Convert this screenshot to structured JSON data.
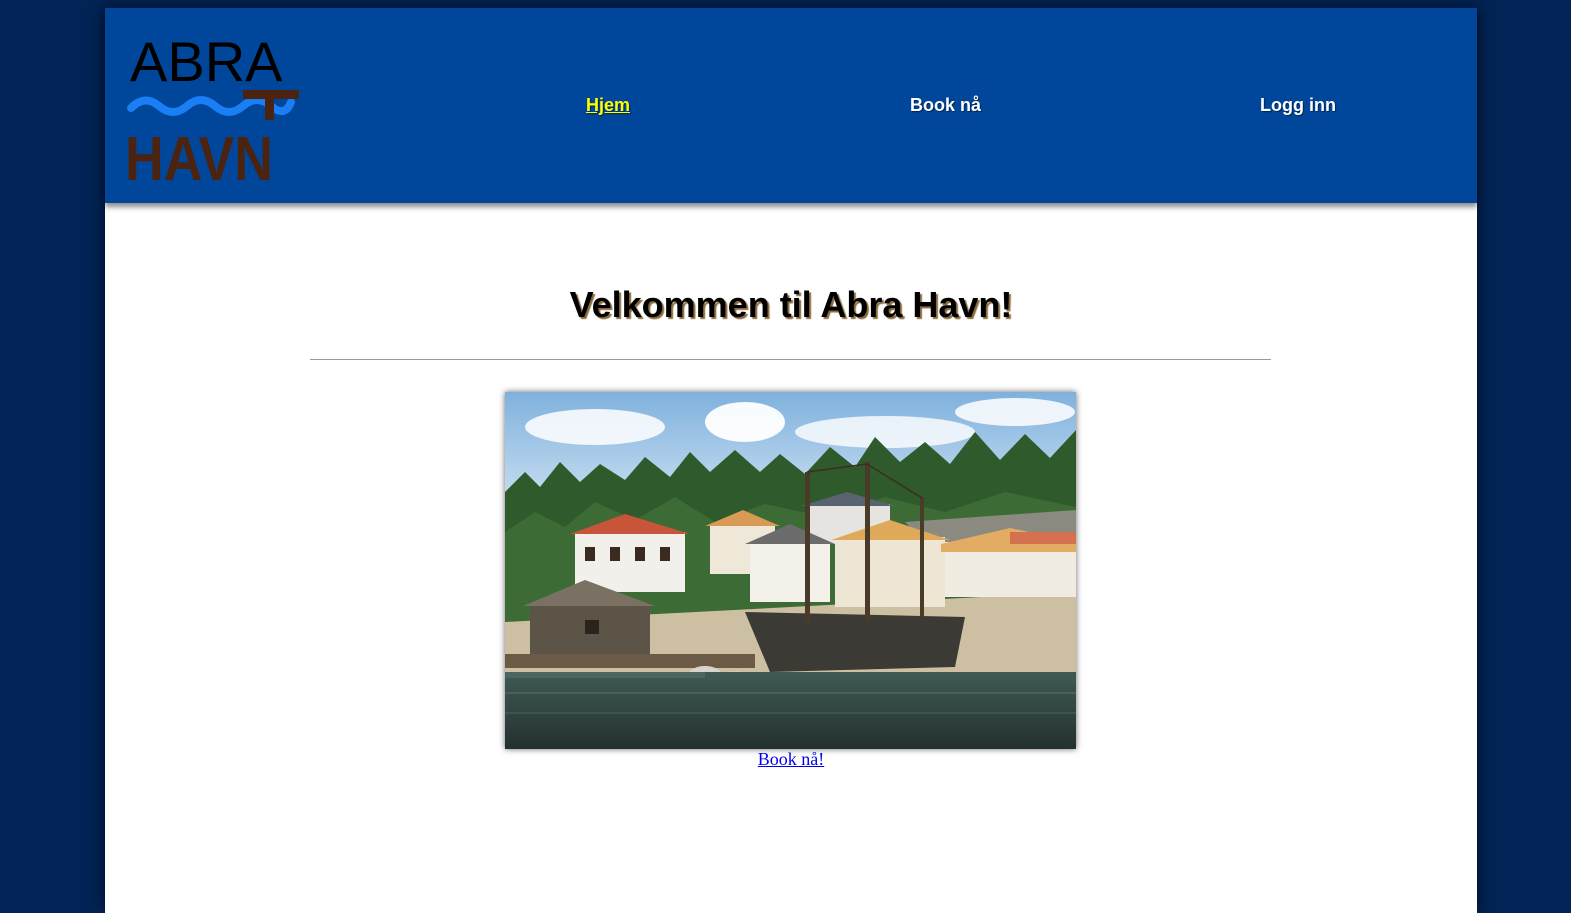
{
  "logo": {
    "line1": "ABRA",
    "line2": "HAVN",
    "colors": {
      "text_top": "#000000",
      "wave": "#1a7ef5",
      "text_bottom": "#4a2410"
    }
  },
  "nav": {
    "items": [
      {
        "label": "Hjem",
        "active": true
      },
      {
        "label": "Book nå",
        "active": false
      },
      {
        "label": "Logg inn",
        "active": false
      }
    ]
  },
  "main": {
    "title": "Velkommen til Abra Havn!",
    "book_link": "Book nå!"
  },
  "colors": {
    "background": "#022456",
    "header": "#00479c",
    "active_nav": "#ffff00",
    "link": "#0000ee"
  }
}
